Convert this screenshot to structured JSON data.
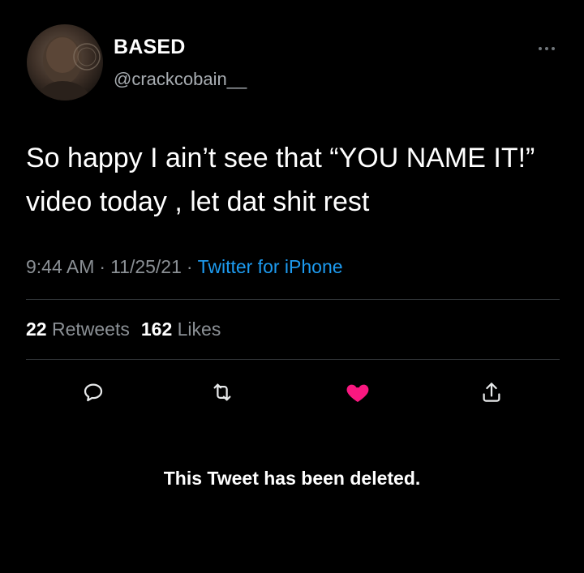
{
  "user": {
    "display_name": "BASED",
    "handle": "@crackcobain__",
    "avatar_icon": "profile-photo"
  },
  "tweet": {
    "text": "So happy I ain’t see that  “YOU NAME IT!” video today , let dat shit rest",
    "time": "9:44 AM",
    "date": "11/25/21",
    "separator": "·",
    "source": "Twitter for iPhone"
  },
  "stats": {
    "retweets_count": "22",
    "retweets_label": "Retweets",
    "likes_count": "162",
    "likes_label": "Likes"
  },
  "actions": {
    "reply_icon": "reply-icon",
    "retweet_icon": "retweet-icon",
    "like_icon": "heart-icon",
    "share_icon": "share-icon",
    "liked": true
  },
  "status_message": "This Tweet has been deleted.",
  "colors": {
    "background": "#000000",
    "accent_link": "#1d9bf0",
    "like": "#f91880",
    "secondary_text": "#8b9095"
  }
}
